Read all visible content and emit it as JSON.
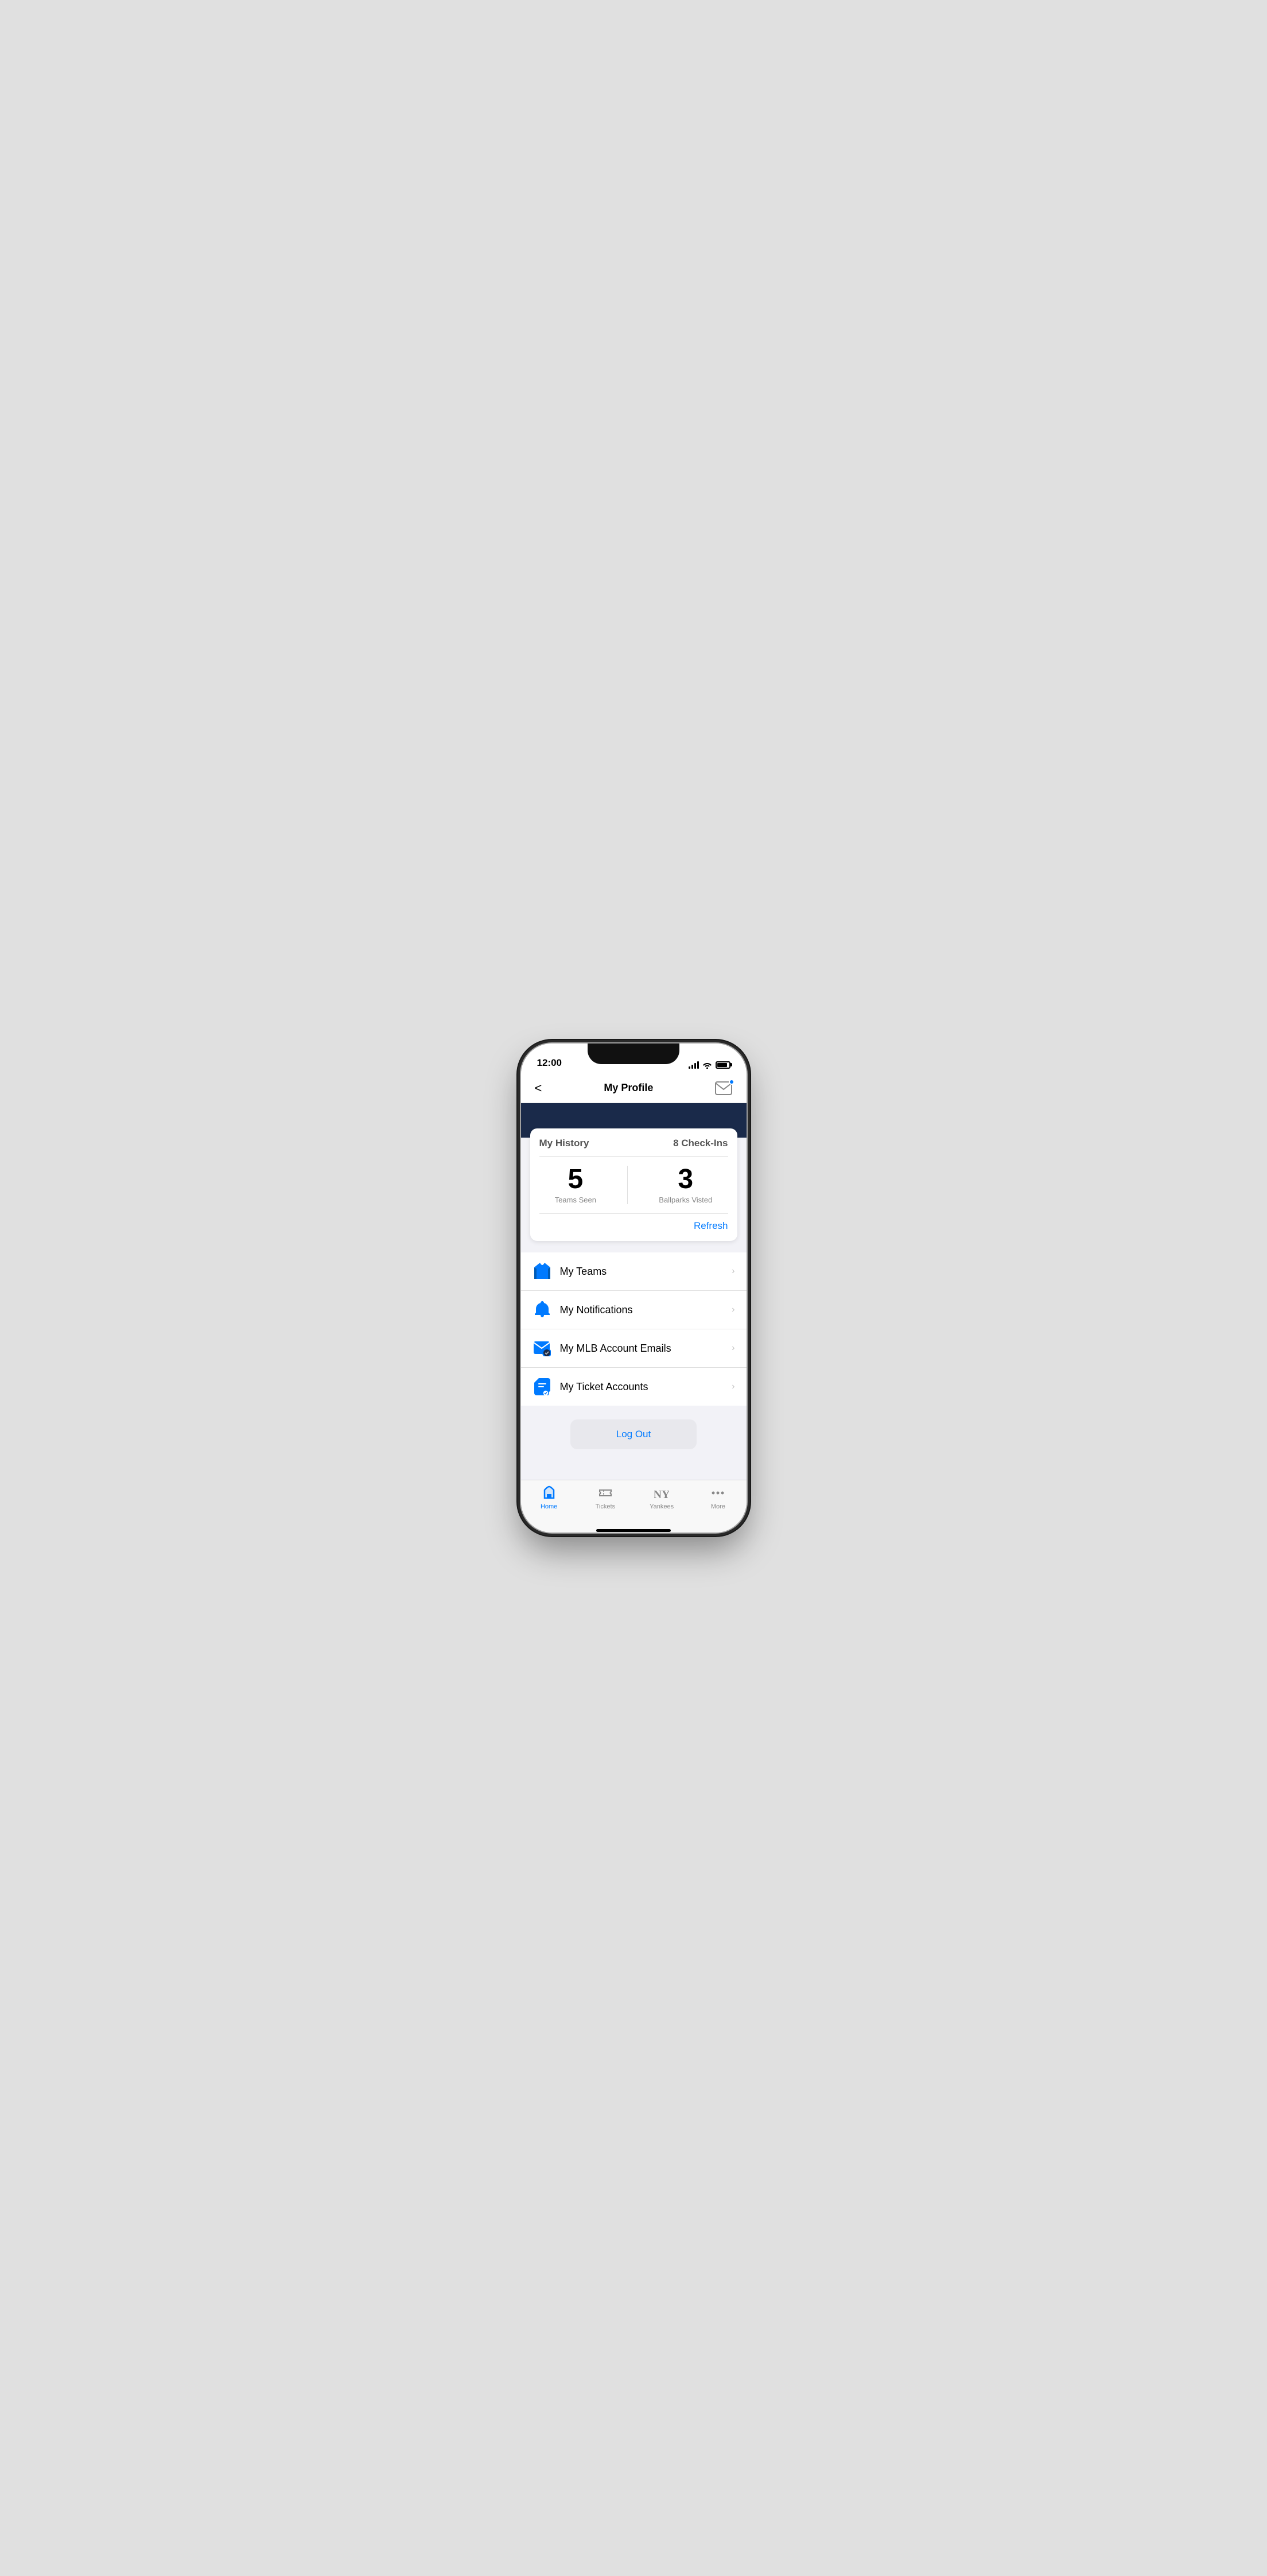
{
  "statusBar": {
    "time": "12:00",
    "signalBars": [
      4,
      7,
      10,
      13
    ],
    "hasBattery": true
  },
  "header": {
    "title": "My Profile",
    "backLabel": "<",
    "mailLabel": "mail"
  },
  "historyCard": {
    "title": "My History",
    "checkinsLabel": "8 Check-Ins",
    "statTeamsNumber": "5",
    "statTeamsLabel": "Teams Seen",
    "statBallparksNumber": "3",
    "statBallparksLabel": "Ballparks Visted",
    "refreshLabel": "Refresh"
  },
  "menuItems": [
    {
      "id": "my-teams",
      "label": "My Teams",
      "icon": "jersey-icon"
    },
    {
      "id": "my-notifications",
      "label": "My Notifications",
      "icon": "bell-icon"
    },
    {
      "id": "my-mlb-emails",
      "label": "My MLB Account Emails",
      "icon": "email-icon"
    },
    {
      "id": "my-ticket-accounts",
      "label": "My Ticket Accounts",
      "icon": "ticket-icon"
    }
  ],
  "logoutLabel": "Log Out",
  "tabBar": {
    "items": [
      {
        "id": "home",
        "label": "Home",
        "active": true,
        "icon": "home-icon"
      },
      {
        "id": "tickets",
        "label": "Tickets",
        "active": false,
        "icon": "tickets-icon"
      },
      {
        "id": "yankees",
        "label": "Yankees",
        "active": false,
        "icon": "yankees-icon"
      },
      {
        "id": "more",
        "label": "More",
        "active": false,
        "icon": "more-icon"
      }
    ]
  },
  "colors": {
    "accent": "#007AFF",
    "darkNavy": "#1a2a4a",
    "activeTab": "#007AFF",
    "inactiveTab": "#888888"
  }
}
